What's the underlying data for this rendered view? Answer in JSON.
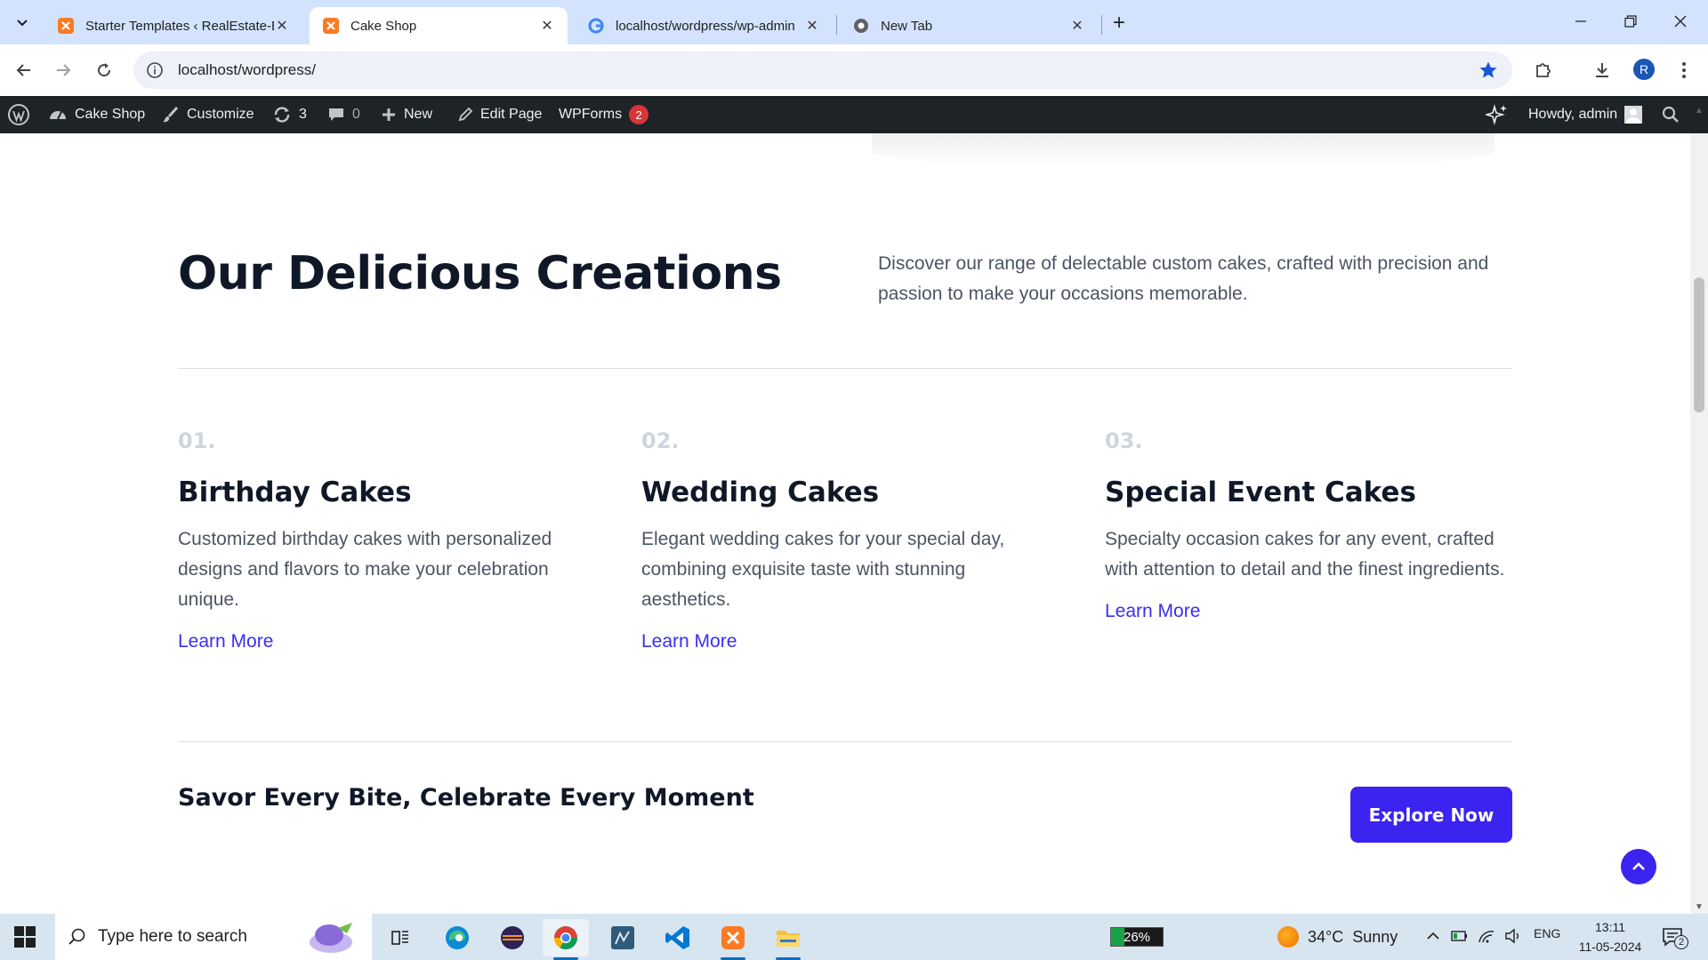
{
  "browser": {
    "tabs": [
      {
        "title": "Starter Templates ‹ RealEstate-E",
        "active": false,
        "icon": "xampp-icon"
      },
      {
        "title": "Cake Shop",
        "active": true,
        "icon": "xampp-icon"
      },
      {
        "title": "localhost/wordpress/wp-admin",
        "active": false,
        "icon": "google-icon"
      },
      {
        "title": "New Tab",
        "active": false,
        "icon": "chrome-icon"
      }
    ],
    "url": "localhost/wordpress/",
    "profile_initial": "R"
  },
  "admin_bar": {
    "site_name": "Cake Shop",
    "customize": "Customize",
    "updates_count": "3",
    "comments_count": "0",
    "new_label": "New",
    "edit_page": "Edit Page",
    "wpforms": "WPForms",
    "wpforms_badge": "2",
    "greeting": "Howdy, admin"
  },
  "section": {
    "heading": "Our Delicious Creations",
    "intro": "Discover our range of delectable custom cakes, crafted with precision and passion to make your occasions memorable."
  },
  "cards": [
    {
      "number": "01.",
      "title": "Birthday Cakes",
      "description": "Customized birthday cakes with personalized designs and flavors to make your celebration unique.",
      "link": "Learn More"
    },
    {
      "number": "02.",
      "title": "Wedding Cakes",
      "description": "Elegant wedding cakes for your special day, combining exquisite taste with stunning aesthetics.",
      "link": "Learn More"
    },
    {
      "number": "03.",
      "title": "Special Event Cakes",
      "description": "Specialty occasion cakes for any event, crafted with attention to detail and the finest ingredients.",
      "link": "Learn More"
    }
  ],
  "cta": {
    "text": "Savor Every Bite, Celebrate Every Moment",
    "button": "Explore Now"
  },
  "taskbar": {
    "search_placeholder": "Type here to search",
    "battery": "26%",
    "battery_level": 0.26,
    "temperature": "34°C",
    "weather": "Sunny",
    "language": "ENG",
    "time": "13:11",
    "date": "11-05-2024",
    "notifications": "2"
  },
  "colors": {
    "accent": "#3b23f0",
    "admin_bar": "#1d2327",
    "tab_strip": "#d3e3fd",
    "heading": "#101828",
    "body_text": "#4b5563"
  }
}
